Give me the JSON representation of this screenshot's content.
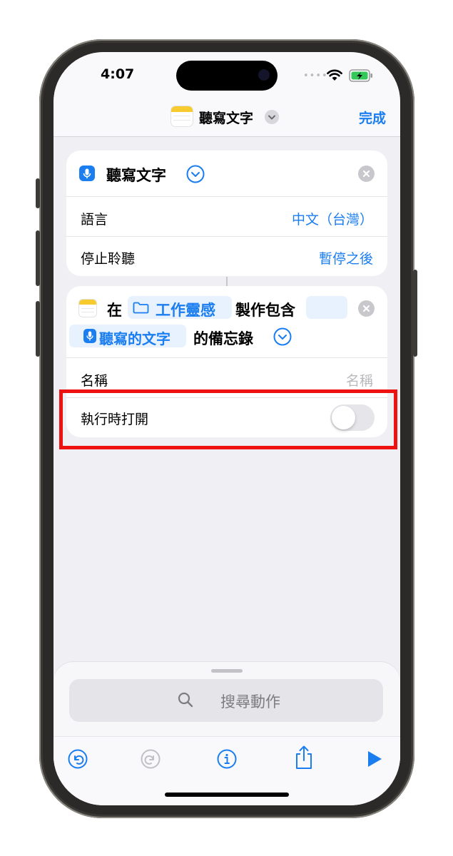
{
  "status_bar": {
    "time": "4:07"
  },
  "nav": {
    "title": "聽寫文字",
    "done_label": "完成"
  },
  "action1": {
    "title": "聽寫文字",
    "rows": [
      {
        "label": "語言",
        "value": "中文（台灣）"
      },
      {
        "label": "停止聆聽",
        "value": "暫停之後"
      }
    ]
  },
  "action2": {
    "prefix": "在",
    "folder": "工作靈感",
    "middle": "製作包含",
    "variable": "聽寫的文字",
    "suffix": "的備忘錄",
    "name_label": "名稱",
    "name_placeholder": "名稱",
    "open_label": "執行時打開",
    "open_on": false
  },
  "search": {
    "placeholder": "搜尋動作"
  },
  "toolbar": {
    "icons": [
      "undo-icon",
      "redo-icon",
      "info-icon",
      "share-icon",
      "play-icon"
    ]
  },
  "colors": {
    "accent": "#1a7df0",
    "highlight": "#ee1111",
    "notes_yellow": "#f7cb2d"
  }
}
